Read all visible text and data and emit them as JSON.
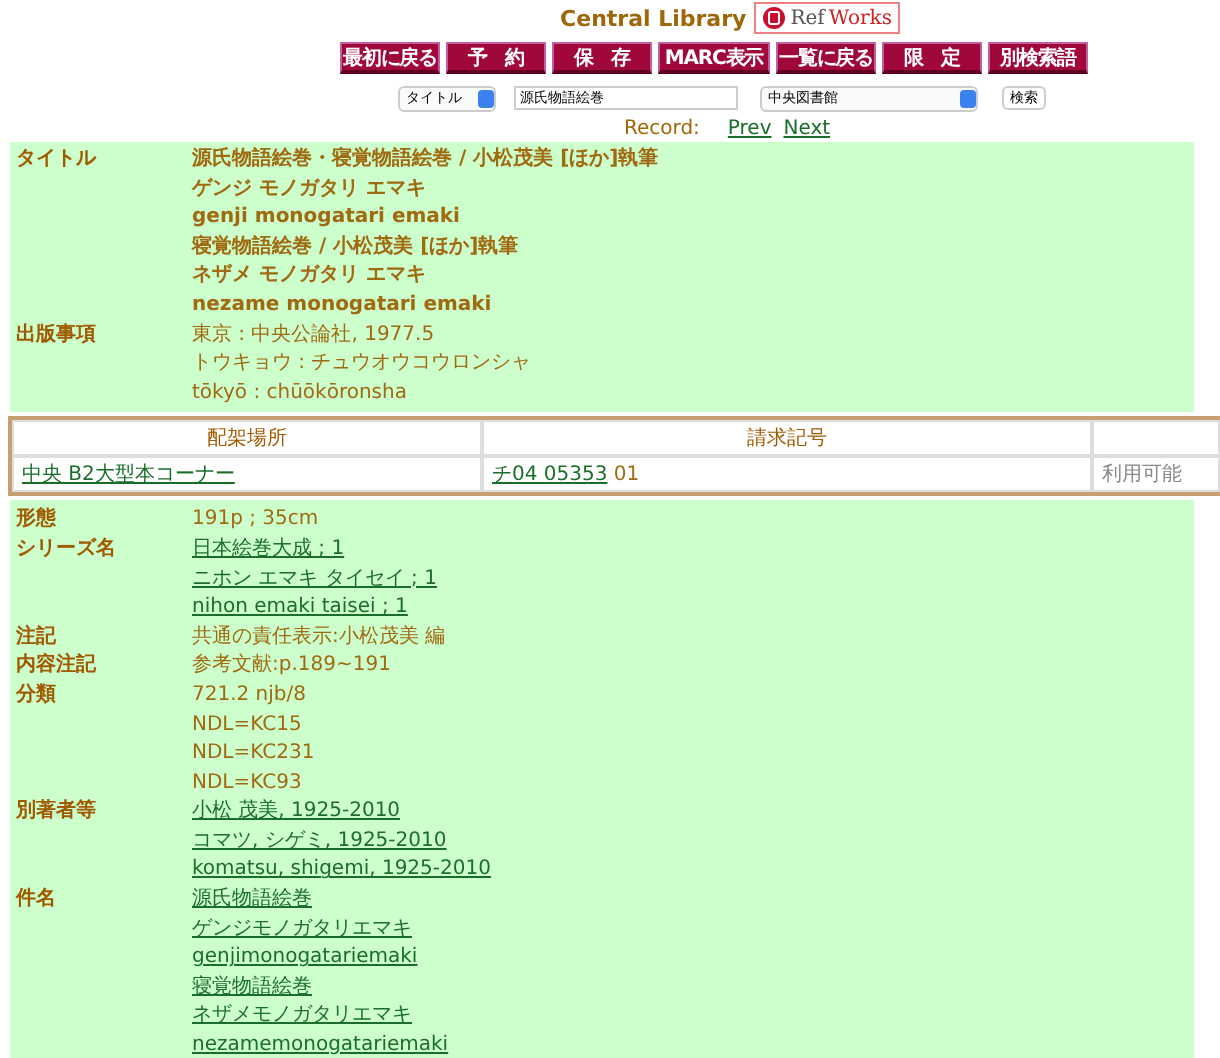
{
  "header": {
    "title": "Central Library",
    "logo": {
      "part_1": "Ref",
      "part_2": "Works"
    }
  },
  "buttons": [
    "最初に戻る",
    "予　約",
    "保　存",
    "MARC表示",
    "一覧に戻る",
    "限　定",
    "別検索語"
  ],
  "search": {
    "field_select": "タイトル",
    "query": "源氏物語絵巻",
    "library_select": "中央図書館",
    "button": "検索"
  },
  "record_nav": {
    "label": "Record:",
    "prev": "Prev",
    "next": "Next"
  },
  "bib_fields": [
    {
      "label": "タイトル",
      "values": [
        {
          "kind": "bold",
          "text": "源氏物語絵巻・寝覚物語絵巻 / 小松茂美 [ほか]執筆"
        },
        {
          "kind": "bold",
          "text": "ゲンジ モノガタリ エマキ"
        },
        {
          "kind": "bold",
          "text": "genji monogatari emaki"
        },
        {
          "kind": "bold",
          "text": "寝覚物語絵巻 / 小松茂美 [ほか]執筆"
        },
        {
          "kind": "bold",
          "text": "ネザメ モノガタリ エマキ"
        },
        {
          "kind": "bold",
          "text": "nezame monogatari emaki"
        }
      ]
    },
    {
      "label": "出版事項",
      "values": [
        {
          "kind": "text",
          "text": "東京 : 中央公論社, 1977.5"
        },
        {
          "kind": "text",
          "text": "トウキョウ : チュウオウコウロンシャ"
        },
        {
          "kind": "text",
          "text": "tōkyō : chūōkōronsha"
        }
      ]
    }
  ],
  "holdings": {
    "columns": [
      "配架場所",
      "請求記号"
    ],
    "rows": [
      {
        "location": "中央 B2大型本コーナー",
        "call_number": "チ04 05353",
        "copy": "01",
        "status": "利用可能"
      }
    ]
  },
  "details": [
    {
      "label": "形態",
      "values": [
        {
          "kind": "text",
          "text": "191p ; 35cm"
        }
      ]
    },
    {
      "label": "シリーズ名",
      "values": [
        {
          "kind": "link",
          "text": "日本絵巻大成 ; 1"
        },
        {
          "kind": "link",
          "text": "ニホン エマキ タイセイ ; 1"
        },
        {
          "kind": "link",
          "text": "nihon emaki taisei ; 1"
        }
      ]
    },
    {
      "label": "注記",
      "values": [
        {
          "kind": "text",
          "text": "共通の責任表示:小松茂美 編"
        }
      ]
    },
    {
      "label": "内容注記",
      "values": [
        {
          "kind": "text",
          "text": "参考文献:p.189~191"
        }
      ]
    },
    {
      "label": "分類",
      "values": [
        {
          "kind": "text",
          "text": "721.2 njb/8"
        },
        {
          "kind": "text",
          "text": "NDL=KC15"
        },
        {
          "kind": "text",
          "text": "NDL=KC231"
        },
        {
          "kind": "text",
          "text": "NDL=KC93"
        }
      ]
    },
    {
      "label": "別著者等",
      "values": [
        {
          "kind": "link",
          "text": "小松 茂美, 1925-2010"
        },
        {
          "kind": "link",
          "text": "コマツ, シゲミ, 1925-2010"
        },
        {
          "kind": "link",
          "text": "komatsu, shigemi, 1925-2010"
        }
      ]
    },
    {
      "label": "件名",
      "values": [
        {
          "kind": "link",
          "text": "源氏物語絵巻"
        },
        {
          "kind": "link",
          "text": "ゲンジモノガタリエマキ"
        },
        {
          "kind": "link",
          "text": "genjimonogatariemaki"
        },
        {
          "kind": "link",
          "text": "寝覚物語絵巻"
        },
        {
          "kind": "link",
          "text": "ネザメモノガタリエマキ"
        },
        {
          "kind": "link",
          "text": "nezamemonogatariemaki"
        }
      ]
    }
  ]
}
